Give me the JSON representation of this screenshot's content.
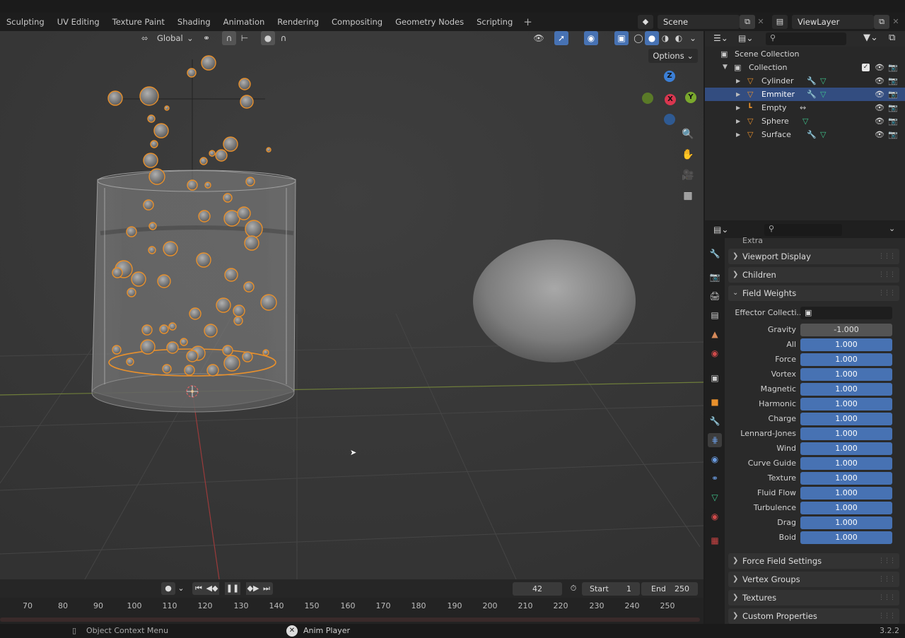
{
  "workspace_tabs": [
    "Sculpting",
    "UV Editing",
    "Texture Paint",
    "Shading",
    "Animation",
    "Rendering",
    "Compositing",
    "Geometry Nodes",
    "Scripting"
  ],
  "scene": {
    "name": "Scene",
    "view_layer": "ViewLayer"
  },
  "viewport": {
    "orientation": "Global",
    "options_label": "Options",
    "axes": {
      "x": "X",
      "y": "Y",
      "z": "Z"
    }
  },
  "timeline": {
    "current_frame": "42",
    "start_label": "Start",
    "start_value": "1",
    "end_label": "End",
    "end_value": "250",
    "ticks": [
      "70",
      "80",
      "90",
      "100",
      "110",
      "120",
      "130",
      "140",
      "150",
      "160",
      "170",
      "180",
      "190",
      "200",
      "210",
      "220",
      "230",
      "240",
      "250"
    ]
  },
  "statusbar": {
    "context_menu": "Object Context Menu",
    "anim_player": "Anim Player",
    "version": "3.2.2"
  },
  "outliner": {
    "scene_collection": "Scene Collection",
    "collection": "Collection",
    "objects": [
      {
        "name": "Cylinder",
        "type": "mesh",
        "selected": false
      },
      {
        "name": "Emmiter",
        "type": "mesh",
        "selected": true
      },
      {
        "name": "Empty",
        "type": "empty",
        "selected": false
      },
      {
        "name": "Sphere",
        "type": "mesh",
        "selected": false
      },
      {
        "name": "Surface",
        "type": "mesh",
        "selected": false
      }
    ]
  },
  "properties": {
    "partial_panel": "Extra",
    "panels_top": [
      "Viewport Display",
      "Children"
    ],
    "field_weights": {
      "title": "Field Weights",
      "effector_label": "Effector Collecti...",
      "rows": [
        {
          "label": "Gravity",
          "value": "-1.000"
        },
        {
          "label": "All",
          "value": "1.000"
        },
        {
          "label": "Force",
          "value": "1.000"
        },
        {
          "label": "Vortex",
          "value": "1.000"
        },
        {
          "label": "Magnetic",
          "value": "1.000"
        },
        {
          "label": "Harmonic",
          "value": "1.000"
        },
        {
          "label": "Charge",
          "value": "1.000"
        },
        {
          "label": "Lennard-Jones",
          "value": "1.000"
        },
        {
          "label": "Wind",
          "value": "1.000"
        },
        {
          "label": "Curve Guide",
          "value": "1.000"
        },
        {
          "label": "Texture",
          "value": "1.000"
        },
        {
          "label": "Fluid Flow",
          "value": "1.000"
        },
        {
          "label": "Turbulence",
          "value": "1.000"
        },
        {
          "label": "Drag",
          "value": "1.000"
        },
        {
          "label": "Boid",
          "value": "1.000"
        }
      ]
    },
    "panels_bottom": [
      "Force Field Settings",
      "Vertex Groups",
      "Textures",
      "Custom Properties"
    ]
  },
  "colors": {
    "accent": "#4772b3",
    "selection": "#334d80",
    "particle": "#e8902c"
  }
}
